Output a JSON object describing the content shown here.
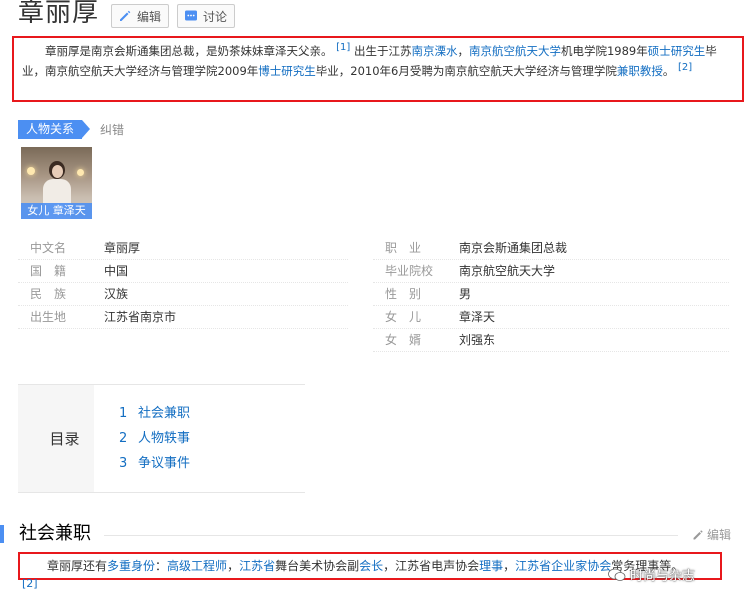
{
  "header": {
    "title": "章丽厚",
    "edit_label": "编辑",
    "discuss_label": "讨论"
  },
  "summary": {
    "p1": "章丽厚是南京会斯通集团总裁，是奶茶妹妹章泽天父亲。",
    "ref1": "[1]",
    "p2": " 出生于江苏",
    "link_lishui": "南京溧水",
    "p3": "，",
    "link_nuaa": "南京航空航天大学",
    "p4": "机电学院1989年",
    "link_master": "硕士研究生",
    "p5": "毕业，南京航空航天大学经济与管理学院2009年",
    "link_phd": "博士研究生",
    "p6": "毕业，2010年6月受聘为南京航空航天大学经济与管理学院",
    "link_adjunct": "兼职教授",
    "p7": "。",
    "ref2": "[2]"
  },
  "relations": {
    "tab_label": "人物关系",
    "fix_label": "纠错",
    "person_label": "女儿 章泽天"
  },
  "basic_info": {
    "left": [
      {
        "key": "中文名",
        "value": "章丽厚",
        "link": false
      },
      {
        "key": "国　籍",
        "value": "中国",
        "link": true
      },
      {
        "key": "民　族",
        "value": "汉族",
        "link": true
      },
      {
        "key": "出生地",
        "value": "江苏省南京市",
        "link": false
      }
    ],
    "right": [
      {
        "key": "职　业",
        "value": "南京会斯通集团总裁",
        "link": true
      },
      {
        "key": "毕业院校",
        "value": "南京航空航天大学",
        "link": true
      },
      {
        "key": "性　别",
        "value": "男",
        "link": true
      },
      {
        "key": "女　儿",
        "value": "章泽天",
        "link": true
      },
      {
        "key": "女　婿",
        "value": "刘强东",
        "link": true
      }
    ]
  },
  "toc": {
    "title": "目录",
    "items": [
      {
        "num": "1",
        "label": "社会兼职"
      },
      {
        "num": "2",
        "label": "人物轶事"
      },
      {
        "num": "3",
        "label": "争议事件"
      }
    ]
  },
  "section": {
    "title": "社会兼职",
    "edit_label": "编辑",
    "t1": "章丽厚还有",
    "l1": "多重身份",
    "t2": "：",
    "l2": "高级工程师",
    "t3": "，",
    "l3": "江苏省",
    "t4": "舞台美术协会副",
    "l4": "会长",
    "t5": "，江苏省电声协会",
    "l5": "理事",
    "t6": "，",
    "l6": "江苏省企业",
    "t7": "家协会",
    "t8": "常务理事等。",
    "ref": "[2]"
  },
  "watermark": {
    "text": "时尚与杂志"
  },
  "colors": {
    "link": "#136ec2",
    "accent": "#4c8ff2",
    "highlight_border": "#e8181c"
  }
}
